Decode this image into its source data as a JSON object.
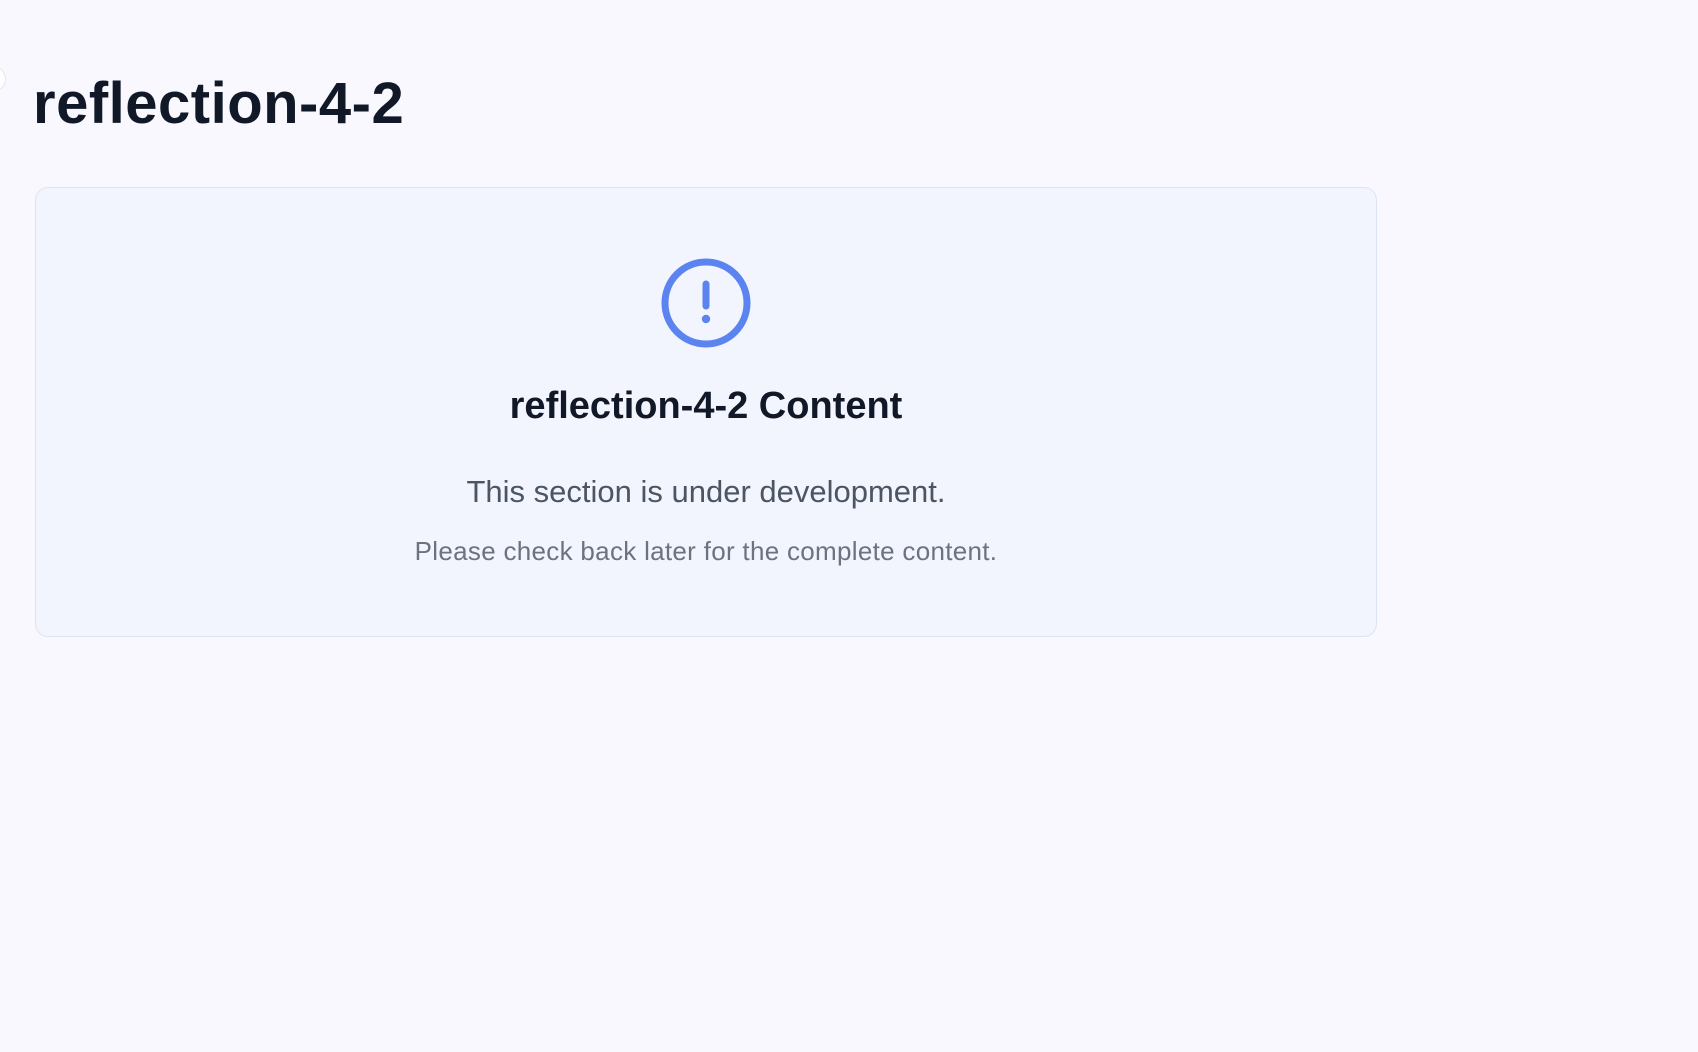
{
  "page": {
    "title": "reflection-4-2"
  },
  "notice": {
    "icon": "alert-circle-icon",
    "accent_color": "#5b84f0",
    "heading": "reflection-4-2 Content",
    "message": "This section is under development.",
    "submessage": "Please check back later for the complete content."
  }
}
